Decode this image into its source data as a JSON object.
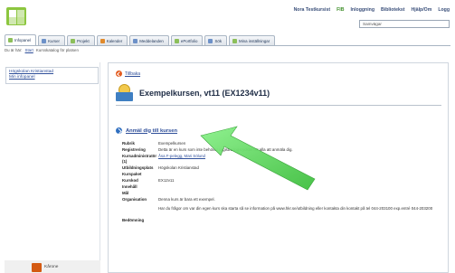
{
  "header": {
    "user_links": [
      "Nora Testkursist",
      "FIB",
      "Inloggning",
      "Bibliotekst",
      "Hjälp/Om",
      "Logg"
    ],
    "search_placeholder": "Samvägar"
  },
  "tabs": [
    {
      "label": "Infopanel",
      "icon": "home-icon"
    },
    {
      "label": "Kurser",
      "icon": "course-icon"
    },
    {
      "label": "Projekt",
      "icon": "project-icon"
    },
    {
      "label": "Kalender",
      "icon": "calendar-icon"
    },
    {
      "label": "Meddelanden",
      "icon": "message-icon"
    },
    {
      "label": "ePortfolio",
      "icon": "portfolio-icon"
    },
    {
      "label": "Sök",
      "icon": "search-icon"
    },
    {
      "label": "Mina inställningar",
      "icon": "settings-icon"
    }
  ],
  "breadcrumb": {
    "prefix": "Du är här:",
    "link": "Start",
    "rest": "Kursskatalog för platsen"
  },
  "sidebar": {
    "links": [
      "Högskolan Kristianstad",
      "Min infopanel"
    ],
    "footer_text": "Kårone"
  },
  "main": {
    "back_label": "Tillbaka",
    "course_title": "Exempelkursen, vt11 (EX1234v11)",
    "apply_label": "Anmäl dig till kursen",
    "details": [
      {
        "key": "Rubrik",
        "value": "Exempelkursen"
      },
      {
        "key": "Registrering",
        "value": "Detta är en kurs som inte behöver registreringsrycktel för alla att anmäla dig."
      },
      {
        "key": "Kursadministratör (1)",
        "value": "Åsa F-pelegg, Mari Sölund",
        "link": true
      },
      {
        "key": "Utbildningsplats",
        "value": "Högskolan Kristianstad"
      },
      {
        "key": "Kurspaket",
        "value": ""
      },
      {
        "key": "Kurskod",
        "value": "EX12v11"
      },
      {
        "key": "Innehåll",
        "value": ""
      },
      {
        "key": "Mål",
        "value": ""
      },
      {
        "key": "Organisation",
        "value": "Denna kurs är bara ett exempel."
      },
      {
        "key": "",
        "value": "Har du frågor om var din egen kurs ska starta så se information på www.hkr.se/utbildning eller kontakta din kontakt på tel 044-203100 exp.entré 044-203200"
      },
      {
        "key": "Bedömning",
        "value": ""
      }
    ]
  },
  "colors": {
    "accent_green": "#8cc63f",
    "link_blue": "#2f4f9a",
    "arrow_green": "#5cd65c"
  }
}
